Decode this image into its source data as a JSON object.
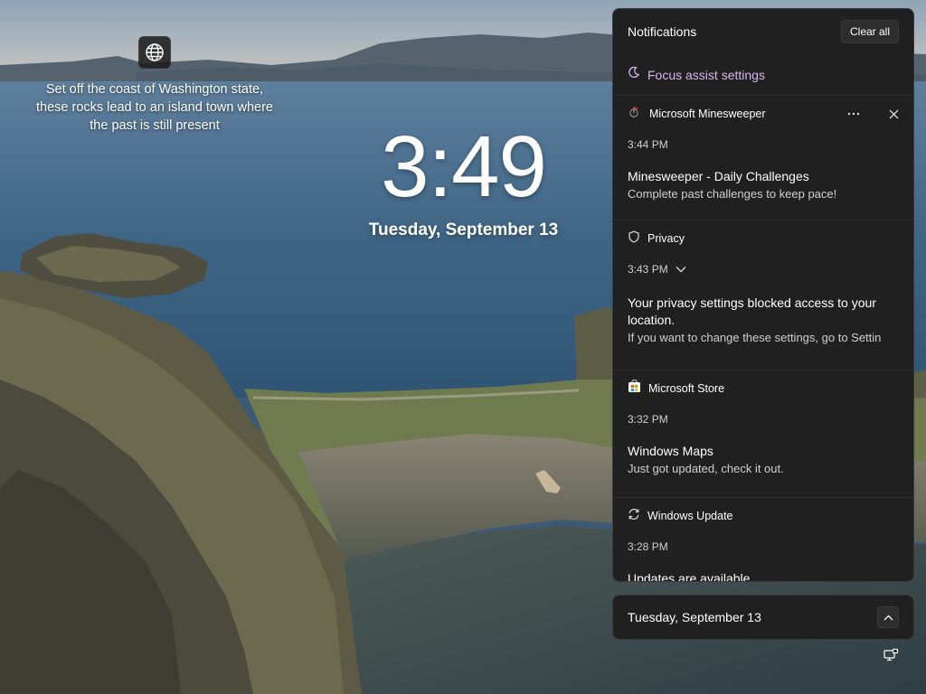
{
  "spotlight": {
    "icon": "globe-icon",
    "text": "Set off the coast of Washington state, these rocks lead to an island town where the past is still present"
  },
  "clock": {
    "time": "3:49",
    "date": "Tuesday, September 13"
  },
  "notifications": {
    "title": "Notifications",
    "clear_all": "Clear all",
    "focus_assist": "Focus assist settings",
    "accent": "#d4b8ef",
    "cards": [
      {
        "app": "Microsoft Minesweeper",
        "icon": "minesweeper-icon",
        "time": "3:44 PM",
        "title": "Minesweeper - Daily Challenges",
        "text": "Complete past challenges to keep pace!"
      },
      {
        "app": "Privacy",
        "icon": "shield-icon",
        "time": "3:43 PM",
        "title": "Your privacy settings blocked access to your location.",
        "text": "If you want to change these settings, go to Settin"
      },
      {
        "app": "Microsoft Store",
        "icon": "store-icon",
        "time": "3:32 PM",
        "title": "Windows Maps",
        "text": "Just got updated, check it out."
      },
      {
        "app": "Windows Update",
        "icon": "sync-icon",
        "time": "3:28 PM",
        "title": "Updates are available",
        "text": ""
      }
    ]
  },
  "date_bar": {
    "label": "Tuesday, September 13"
  }
}
